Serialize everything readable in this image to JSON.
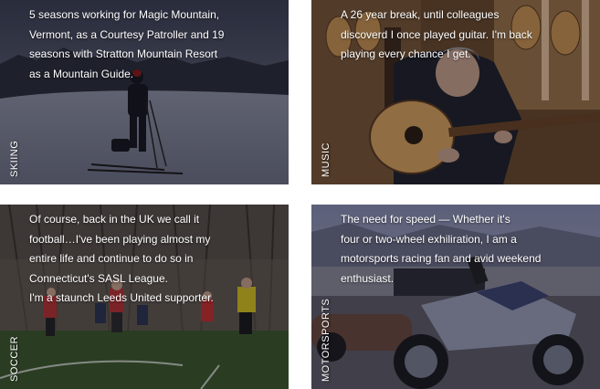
{
  "tiles": [
    {
      "label": "SKIING",
      "caption": "5 seasons working for Magic Mountain,\nVermont, as a Courtesy Patroller and 19\nseasons with Stratton Mountain Resort\nas a Mountain Guide."
    },
    {
      "label": "MUSIC",
      "caption": "A 26 year break, until colleagues\ndiscoverd I once played guitar. I'm back\nplaying every chance I get."
    },
    {
      "label": "SOCCER",
      "caption": "Of course, back in the UK we call it\nfootball…I've been playing almost my\nentire life and continue to do so in\nConnecticut's SASL League.\nI'm a staunch Leeds United supporter."
    },
    {
      "label": "MOTORSPORTS",
      "caption": "The need for speed — Whether it's\nfour or two-wheel exhiliration, I am a\nmotorsports racing fan and avid weekend\nenthusiast."
    }
  ]
}
